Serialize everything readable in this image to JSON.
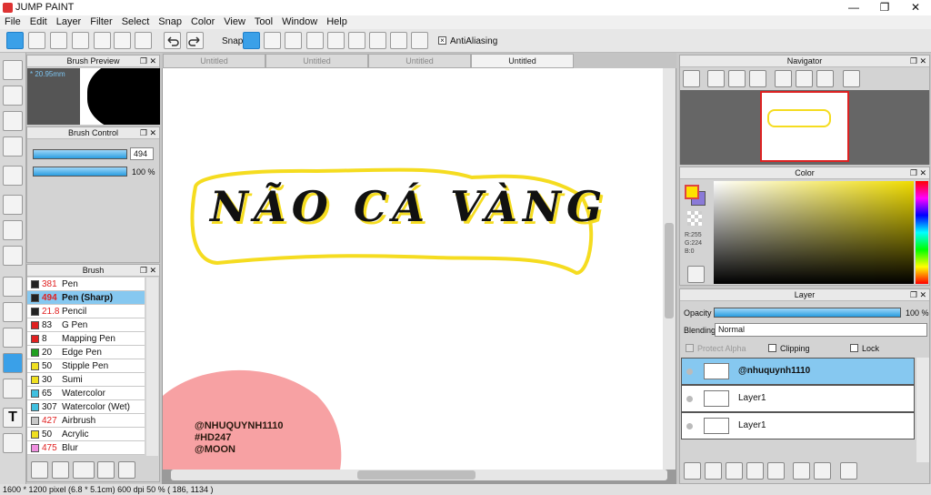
{
  "window": {
    "title": "JUMP PAINT",
    "min": "—",
    "max": "❐",
    "close": "✕"
  },
  "menu": [
    "File",
    "Edit",
    "Layer",
    "Filter",
    "Select",
    "Snap",
    "Color",
    "View",
    "Tool",
    "Window",
    "Help"
  ],
  "toolbar": {
    "snap_label": "Snap",
    "antialias_label": "AntiAliasing"
  },
  "brush_preview": {
    "title": "Brush Preview",
    "size": "* 20.95mm"
  },
  "brush_control": {
    "title": "Brush Control",
    "size": "494",
    "opacity": "100 %"
  },
  "brush": {
    "title": "Brush",
    "items": [
      {
        "size": "381",
        "name": "Pen",
        "color": "#222222",
        "size_red": true
      },
      {
        "size": "494",
        "name": "Pen (Sharp)",
        "color": "#222222",
        "size_red": true,
        "selected": true
      },
      {
        "size": "21.8",
        "name": "Pencil",
        "color": "#222222",
        "size_red": true
      },
      {
        "size": "83",
        "name": "G Pen",
        "color": "#e02020"
      },
      {
        "size": "8",
        "name": "Mapping Pen",
        "color": "#e02020"
      },
      {
        "size": "20",
        "name": "Edge Pen",
        "color": "#20a020"
      },
      {
        "size": "50",
        "name": "Stipple Pen",
        "color": "#f0e020"
      },
      {
        "size": "30",
        "name": "Sumi",
        "color": "#f0e020"
      },
      {
        "size": "65",
        "name": "Watercolor",
        "color": "#40c0e0"
      },
      {
        "size": "307",
        "name": "Watercolor (Wet)",
        "color": "#40c0e0"
      },
      {
        "size": "427",
        "name": "Airbrush",
        "color": "#c8c8c8",
        "size_red": true
      },
      {
        "size": "50",
        "name": "Acrylic",
        "color": "#f0e020"
      },
      {
        "size": "475",
        "name": "Blur",
        "color": "#f090e0",
        "size_red": true
      }
    ]
  },
  "tabs": [
    "Untitled",
    "Untitled",
    "Untitled",
    "Untitled"
  ],
  "canvas": {
    "heading": "NÃO CÁ VÀNG",
    "credits": [
      "@NHUQUYNH1110",
      "#HD247",
      "@MOON"
    ]
  },
  "navigator": {
    "title": "Navigator"
  },
  "color": {
    "title": "Color",
    "rgb": [
      "R:255",
      "G:224",
      "B:0"
    ],
    "fg": "#ffe000"
  },
  "layer": {
    "title": "Layer",
    "opacity_label": "Opacity",
    "opacity_value": "100 %",
    "blending_label": "Blending",
    "blending_value": "Normal",
    "protect_alpha": "Protect Alpha",
    "clipping": "Clipping",
    "lock": "Lock",
    "layers": [
      {
        "name": "@nhuquynh1110",
        "selected": true
      },
      {
        "name": "Layer1"
      },
      {
        "name": "Layer1"
      }
    ]
  },
  "status": "1600 * 1200 pixel   (6.8 * 5.1cm)   600 dpi   50 %   ( 186, 1134 )"
}
